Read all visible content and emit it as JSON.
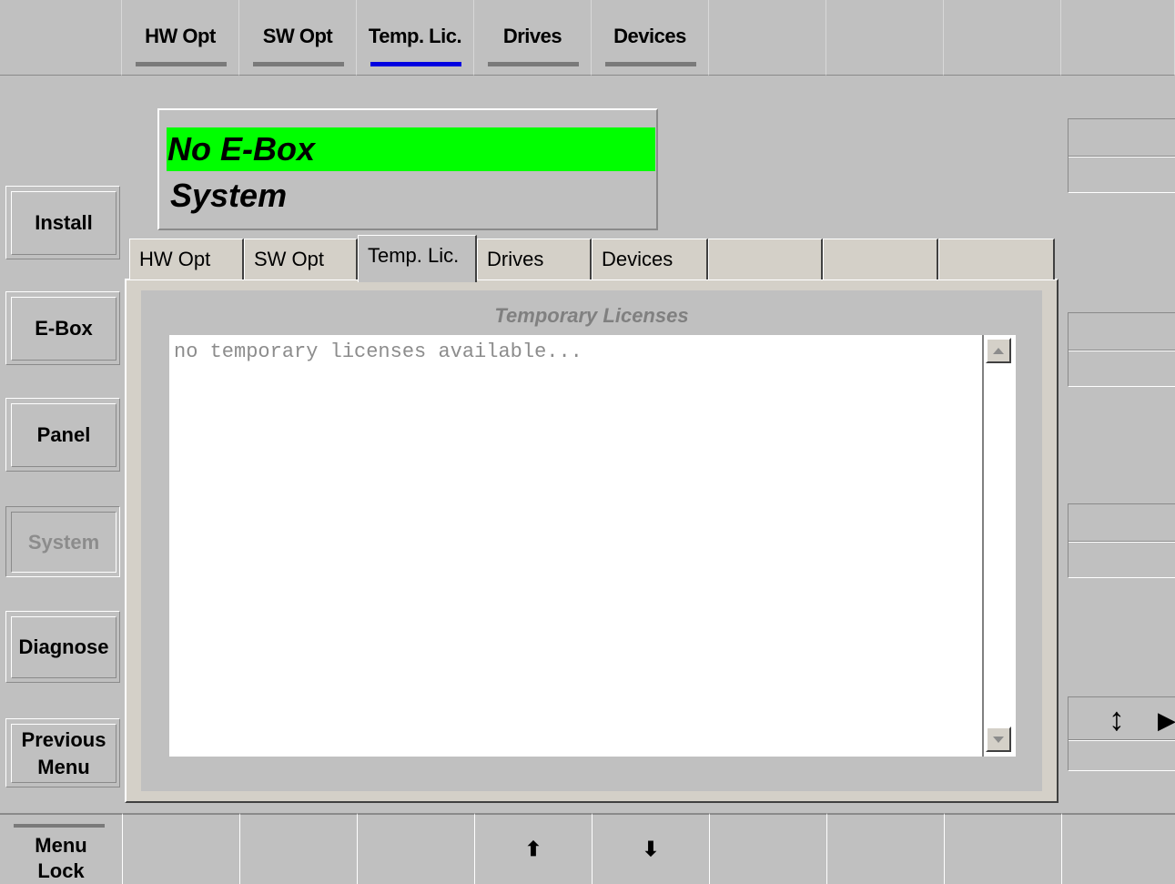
{
  "top_tabs": [
    {
      "label": "HW Opt",
      "active": false
    },
    {
      "label": "SW Opt",
      "active": false
    },
    {
      "label": "Temp. Lic.",
      "active": true
    },
    {
      "label": "Drives",
      "active": false
    },
    {
      "label": "Devices",
      "active": false
    },
    {
      "label": "",
      "active": false
    },
    {
      "label": "",
      "active": false
    },
    {
      "label": "",
      "active": false
    }
  ],
  "side_menu": {
    "install": "Install",
    "ebox": "E-Box",
    "panel": "Panel",
    "system": "System",
    "diagnose": "Diagnose",
    "previous_menu_1": "Previous",
    "previous_menu_2": "Menu"
  },
  "status": {
    "line1": "No E-Box",
    "line2": "System",
    "line1_color": "#00ff00"
  },
  "inner_tabs": [
    {
      "label": "HW Opt"
    },
    {
      "label": "SW Opt"
    },
    {
      "label": "Temp. Lic."
    },
    {
      "label": "Drives"
    },
    {
      "label": "Devices"
    },
    {
      "label": ""
    },
    {
      "label": ""
    },
    {
      "label": ""
    }
  ],
  "panel": {
    "title": "Temporary Licenses",
    "list_text": "no temporary licenses available..."
  },
  "bottom_bar": {
    "menu_lock_1": "Menu",
    "menu_lock_2": "Lock",
    "up_arrow": "⬆",
    "down_arrow": "⬇"
  },
  "right_bar": {
    "scroll_icon": "↕",
    "right_arrow": "▶"
  },
  "colors": {
    "background": "#c0c0c0",
    "active_tab_indicator": "#0000e0",
    "status_highlight": "#00ff00"
  }
}
